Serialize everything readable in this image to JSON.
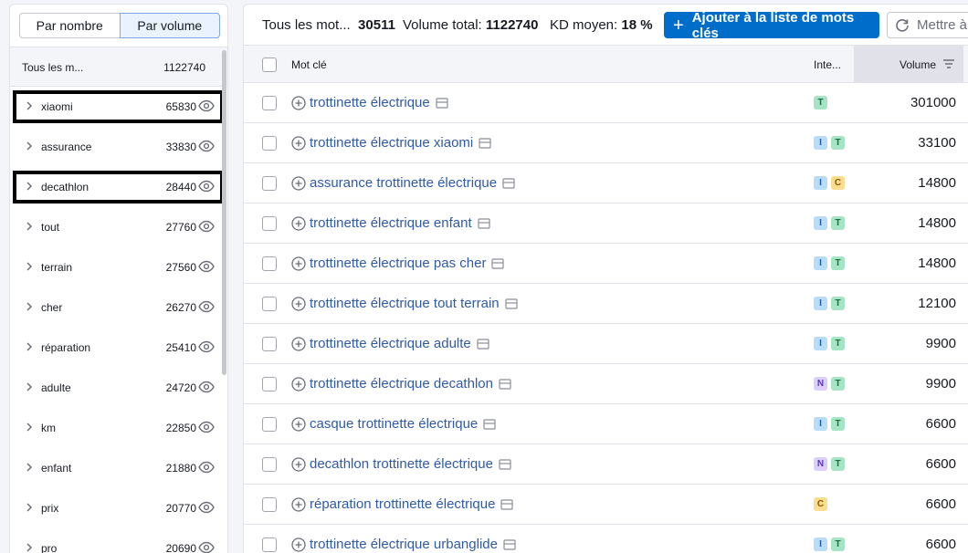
{
  "sidebar": {
    "toggle": {
      "by_number": "Par nombre",
      "by_volume": "Par volume"
    },
    "header": {
      "label": "Tous les m...",
      "value": "1122740"
    },
    "groups": [
      {
        "name": "xiaomi",
        "count": "65830",
        "highlighted": true
      },
      {
        "name": "assurance",
        "count": "33830"
      },
      {
        "name": "decathlon",
        "count": "28440",
        "highlighted": true
      },
      {
        "name": "tout",
        "count": "27760"
      },
      {
        "name": "terrain",
        "count": "27560"
      },
      {
        "name": "cher",
        "count": "26270"
      },
      {
        "name": "réparation",
        "count": "25410"
      },
      {
        "name": "adulte",
        "count": "24720"
      },
      {
        "name": "km",
        "count": "22850"
      },
      {
        "name": "enfant",
        "count": "21880"
      },
      {
        "name": "prix",
        "count": "20770"
      },
      {
        "name": "pro",
        "count": "20690"
      }
    ]
  },
  "summary": {
    "all_label": "Tous les mot...",
    "all_value": "30511",
    "volume_label": "Volume total:",
    "volume_value": "1122740",
    "kd_label": "KD moyen:",
    "kd_value": "18 %"
  },
  "toolbar": {
    "add_label": "Ajouter à la liste de mots clés",
    "update_label": "Mettre à"
  },
  "table": {
    "headers": {
      "keyword": "Mot clé",
      "intent": "Inte...",
      "volume": "Volume"
    },
    "rows": [
      {
        "keyword": "trottinette électrique",
        "intents": [
          "T"
        ],
        "volume": "301000"
      },
      {
        "keyword": "trottinette électrique xiaomi",
        "intents": [
          "I",
          "T"
        ],
        "volume": "33100"
      },
      {
        "keyword": "assurance trottinette électrique",
        "intents": [
          "I",
          "C"
        ],
        "volume": "14800"
      },
      {
        "keyword": "trottinette électrique enfant",
        "intents": [
          "I",
          "T"
        ],
        "volume": "14800"
      },
      {
        "keyword": "trottinette électrique pas cher",
        "intents": [
          "I",
          "T"
        ],
        "volume": "14800"
      },
      {
        "keyword": "trottinette électrique tout terrain",
        "intents": [
          "I",
          "T"
        ],
        "volume": "12100"
      },
      {
        "keyword": "trottinette électrique adulte",
        "intents": [
          "I",
          "T"
        ],
        "volume": "9900"
      },
      {
        "keyword": "trottinette électrique decathlon",
        "intents": [
          "N",
          "T"
        ],
        "volume": "9900"
      },
      {
        "keyword": "casque trottinette électrique",
        "intents": [
          "I",
          "T"
        ],
        "volume": "6600"
      },
      {
        "keyword": "decathlon trottinette électrique",
        "intents": [
          "N",
          "T"
        ],
        "volume": "6600"
      },
      {
        "keyword": "réparation trottinette électrique",
        "intents": [
          "C"
        ],
        "volume": "6600"
      },
      {
        "keyword": "trottinette électrique urbanglide",
        "intents": [
          "I",
          "T"
        ],
        "volume": "6600"
      }
    ]
  },
  "colors": {
    "primary": "#006dca",
    "link": "#2f5aa8",
    "highlight_border": "#000000"
  }
}
